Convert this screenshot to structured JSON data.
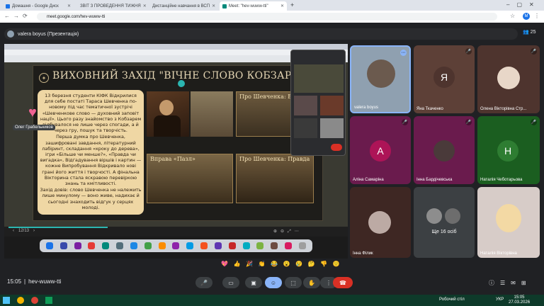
{
  "browser": {
    "tabs": [
      {
        "label": "Домашня - Google Диск",
        "color": "#1a73e8"
      },
      {
        "label": "ЗВІТ З ПРОВЕДЕННЯ ТИЖНЯ",
        "color": "#34a853"
      },
      {
        "label": "Дистанційне навчання в ВСП",
        "color": "#fbbc04"
      },
      {
        "label": "Meet: \"hev-wuww-tti\"",
        "color": "#00897b"
      }
    ],
    "url": "meet.google.com/hev-wuww-tti"
  },
  "presenter": {
    "label": "valera boyus (Презентація)",
    "participant_count": "25"
  },
  "slide": {
    "title": "ВИХОВНИЙ ЗАХІД \"ВІЧНЕ СЛОВО КОБЗАРЯ\"",
    "paragraphs": [
      "13 березня студенти КІФК Відкрилися для себе постаті Тараса Шевченка по-новому під час тематичної зустрічі «Шевченкове слово — духовний заповіт нації». Цього разу знайомство з Кобзарем відбувалося не лише через спогади, а й через гру, пошук та творчість.",
      "Перша думка про Шевченка, зашифровані завдання, літературний лабіринт, складання «кроку до дерева», ігри «Більше чи менше?», «Правда чи вигадка», Відгадування віршів і картин — кожне Випробування Відкривало нові грані його життя і творчості. А фінальна Вікторина стала яскравою перевіркою знань та кмітливості.",
      "Захід довів: слово Шевченка не належить лише минулому — воно живе, надихає й сьогодні знаходить відгук у серцях молоді."
    ],
    "photo_labels": [
      "Про Шевченка: Вірш",
      "Вправа «Пазл»",
      "Про Шевченка: Правда"
    ],
    "page": "12/13",
    "overlay_name": "Олег Грабельников"
  },
  "participants": [
    {
      "name": "valera boyus",
      "initial": "",
      "color": "#8fa0b0",
      "muted": false
    },
    {
      "name": "Яна Ткаченко",
      "initial": "Я",
      "color": "#5d4037",
      "muted": true
    },
    {
      "name": "Олена Вікторівна Стр...",
      "initial": "",
      "color": "#e8d7c8",
      "muted": true
    },
    {
      "name": "Аліна Самаріна",
      "initial": "А",
      "color": "#ad1457",
      "muted": true
    },
    {
      "name": "Інна Бардічевська",
      "initial": "",
      "color": "#6a1b4d",
      "muted": true
    },
    {
      "name": "Наталія Чеботарьова",
      "initial": "Н",
      "color": "#2e7d32",
      "muted": true
    },
    {
      "name": "Інна Філик",
      "initial": "",
      "color": "#3e2723",
      "muted": false
    },
    {
      "name": "Ще 16 осіб",
      "initial": "",
      "color": "#3c4043",
      "muted": false
    },
    {
      "name": "Наталія Вікторівна",
      "initial": "",
      "color": "#d7ccc8",
      "muted": false
    }
  ],
  "meeting": {
    "time": "15:05",
    "code": "hev-wuww-tti"
  },
  "reactions": [
    "💖",
    "👍",
    "🎉",
    "👏",
    "😂",
    "😮",
    "😢",
    "🤔",
    "👎",
    "🙂"
  ],
  "taskbar": {
    "time": "15:05",
    "date": "27.03.2026",
    "lang": "УКР",
    "desktop_label": "Робочий стіл"
  }
}
